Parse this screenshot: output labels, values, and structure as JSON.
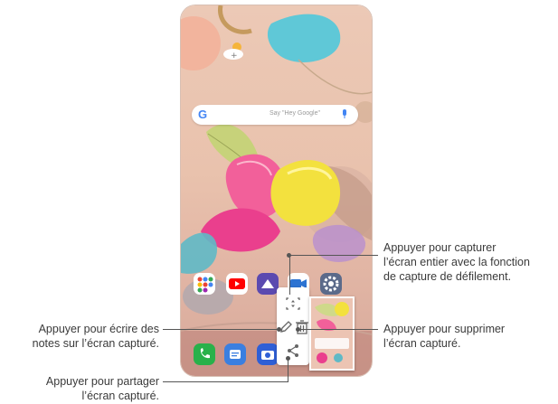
{
  "search": {
    "placeholder": "Say \"Hey Google\""
  },
  "toolbar": {
    "buttons": [
      {
        "icon": "scroll-capture-icon"
      },
      {
        "icon": "edit-pen-icon"
      },
      {
        "icon": "delete-icon"
      },
      {
        "icon": "share-icon"
      }
    ]
  },
  "callouts": {
    "scroll_capture": [
      "Appuyer pour capturer",
      "l’écran entier avec la fonction",
      "de capture de défilement."
    ],
    "write_notes": [
      "Appuyer pour écrire des",
      "notes sur l’écran capturé."
    ],
    "delete": [
      "Appuyer pour supprimer",
      "l’écran capturé."
    ],
    "share": [
      "Appuyer pour partager",
      "l’écran capturé."
    ]
  },
  "colors": {
    "accent_line": "#555555",
    "wallpaper": "#e9c2ad",
    "youtube": "#ff0000",
    "gallery": "#5b4ab0",
    "video": "#2c73d2",
    "settings": "#5b6a8a",
    "phone_app": "#29b14a",
    "messages": "#3b7fe0",
    "camera": "#2f5fd6"
  }
}
